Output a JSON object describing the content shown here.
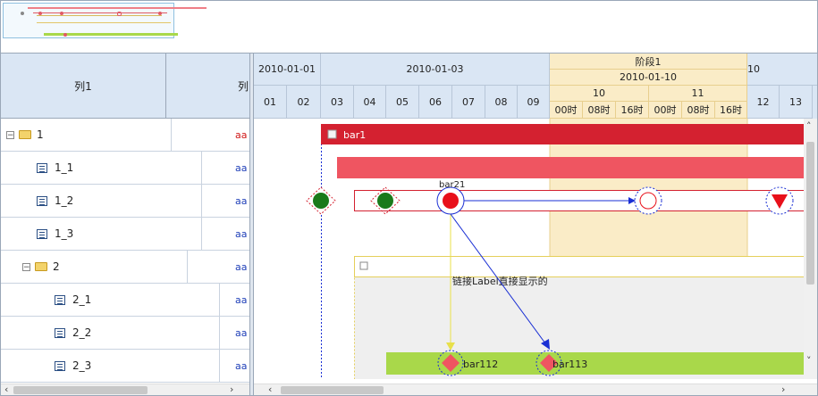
{
  "left_grid": {
    "columns": [
      "列1",
      "列"
    ],
    "rows": [
      {
        "label": "1",
        "value": "aa",
        "value_color": "red"
      },
      {
        "label": "1_1",
        "value": "aa"
      },
      {
        "label": "1_2",
        "value": "aa"
      },
      {
        "label": "1_3",
        "value": "aa"
      },
      {
        "label": "2",
        "value": "aa"
      },
      {
        "label": "2_1",
        "value": "aa"
      },
      {
        "label": "2_2",
        "value": "aa"
      },
      {
        "label": "2_3",
        "value": "aa"
      }
    ]
  },
  "timeline": {
    "date_row": [
      "2010-01-01",
      "2010-01-03",
      "10"
    ],
    "stage": {
      "label": "阶段1",
      "date": "2010-01-10",
      "days": [
        "10",
        "11"
      ],
      "hours": [
        "00时",
        "08时",
        "16时",
        "00时",
        "08时",
        "16时"
      ]
    },
    "days": [
      "01",
      "02",
      "03",
      "04",
      "05",
      "06",
      "07",
      "08",
      "09",
      "12",
      "13"
    ]
  },
  "gantt": {
    "bar1_label": "bar1",
    "bar21_label": "bar21",
    "link_label": "链接Label直接显示的",
    "bar112_label": "bar112",
    "bar113_label": "bar113",
    "colors": {
      "bar1": "#d42130",
      "bar_sub": "#ef5561",
      "green_bar": "#a9d84a",
      "highlight": "#faecc7",
      "link": "#1a2fd4"
    }
  },
  "scroll": {
    "left_arrow": "‹",
    "right_arrow": "›",
    "up_arrow": "˄",
    "down_arrow": "˅"
  }
}
